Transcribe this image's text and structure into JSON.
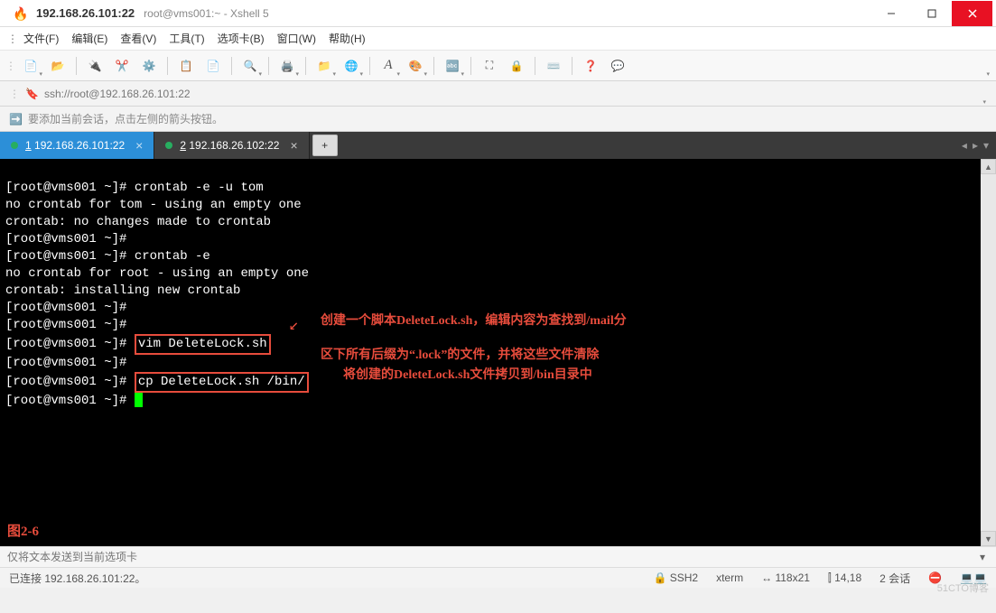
{
  "titlebar": {
    "ip": "192.168.26.101:22",
    "subtitle": "root@vms001:~ - Xshell 5"
  },
  "menu": {
    "file": "文件(F)",
    "edit": "编辑(E)",
    "view": "查看(V)",
    "tools": "工具(T)",
    "tabs": "选项卡(B)",
    "window": "窗口(W)",
    "help": "帮助(H)"
  },
  "address": {
    "url": "ssh://root@192.168.26.101:22"
  },
  "tip": {
    "text": "要添加当前会话，点击左侧的箭头按钮。"
  },
  "tabs": [
    {
      "num": "1",
      "label": "192.168.26.101:22",
      "active": true
    },
    {
      "num": "2",
      "label": "192.168.26.102:22",
      "active": false
    }
  ],
  "terminal": {
    "lines": [
      "[root@vms001 ~]# crontab -e -u tom",
      "no crontab for tom - using an empty one",
      "crontab: no changes made to crontab",
      "[root@vms001 ~]#",
      "[root@vms001 ~]# crontab -e",
      "no crontab for root - using an empty one",
      "crontab: installing new crontab",
      "[root@vms001 ~]#",
      "[root@vms001 ~]#",
      "[root@vms001 ~]# ",
      "[root@vms001 ~]#",
      "[root@vms001 ~]# ",
      "[root@vms001 ~]# "
    ],
    "cmd1": "vim DeleteLock.sh",
    "cmd2": "cp DeleteLock.sh /bin/",
    "anno1": "创建一个脚本DeleteLock.sh，编辑内容为查找到/mail分",
    "anno2": "区下所有后缀为“.lock”的文件，并将这些文件清除",
    "anno3": "将创建的DeleteLock.sh文件拷贝到/bin目录中",
    "figlabel": "图2-6"
  },
  "sendbar": {
    "placeholder": "仅将文本发送到当前选项卡"
  },
  "status": {
    "connected": "已连接 192.168.26.101:22。",
    "protocol": "SSH2",
    "term": "xterm",
    "size": "118x21",
    "pos": "14,18",
    "sessions": "2 会话"
  },
  "watermark": "51CTO博客"
}
